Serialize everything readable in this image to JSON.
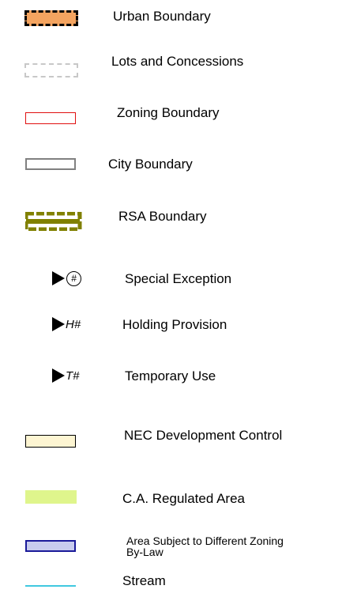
{
  "legend": {
    "items": [
      {
        "id": "urban-boundary",
        "label": "Urban Boundary",
        "symbol": "dashed-box",
        "fill": "#f4a460",
        "stroke": "#000000"
      },
      {
        "id": "lots-concessions",
        "label": "Lots and Concessions",
        "symbol": "dashed-box",
        "fill": "#ffffff",
        "stroke": "#c8c8c8"
      },
      {
        "id": "zoning-boundary",
        "label": "Zoning Boundary",
        "symbol": "box",
        "fill": "#ffffff",
        "stroke": "#e01010"
      },
      {
        "id": "city-boundary",
        "label": "City Boundary",
        "symbol": "box",
        "fill": "#ffffff",
        "stroke": "#808080"
      },
      {
        "id": "rsa-boundary",
        "label": "RSA Boundary",
        "symbol": "dashed-band",
        "fill": "#6b6b00",
        "stroke": "#808000"
      },
      {
        "id": "special-exception",
        "label": "Special Exception",
        "symbol": "arrow-marker",
        "marker": "#"
      },
      {
        "id": "holding-provision",
        "label": "Holding Provision",
        "symbol": "arrow-marker",
        "marker": "H#"
      },
      {
        "id": "temporary-use",
        "label": "Temporary Use",
        "symbol": "arrow-marker",
        "marker": "T#"
      },
      {
        "id": "nec-development-control",
        "label": "NEC Development Control",
        "symbol": "box",
        "fill": "#fdf5d2",
        "stroke": "#000000"
      },
      {
        "id": "ca-regulated-area",
        "label": "C.A. Regulated Area",
        "symbol": "filled-band",
        "fill": "#dff58c"
      },
      {
        "id": "different-zoning-bylaw",
        "label": "Area Subject to Different Zoning  By-Law",
        "symbol": "box",
        "fill": "#c8ccee",
        "stroke": "#1a1a99"
      },
      {
        "id": "stream",
        "label": "Stream",
        "symbol": "line",
        "stroke": "#40c8e0"
      }
    ]
  }
}
